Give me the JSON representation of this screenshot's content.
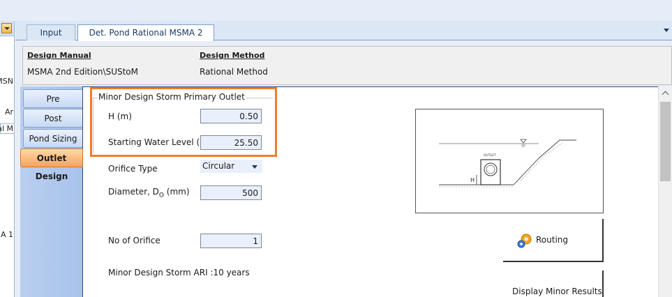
{
  "left_pane": {
    "fragments": [
      "MSN",
      "Ar",
      "al M",
      "A 1"
    ]
  },
  "tabs": [
    {
      "label": "Input",
      "active": false
    },
    {
      "label": "Det. Pond Rational MSMA 2",
      "active": true
    }
  ],
  "header": {
    "design_manual_label": "Design Manual",
    "design_manual_value": "MSMA 2nd Edition\\SUStoM",
    "design_method_label": "Design Method",
    "design_method_value": "Rational Method"
  },
  "side_tabs": [
    {
      "label": "Pre",
      "active": false
    },
    {
      "label": "Post",
      "active": false
    },
    {
      "label": "Pond Sizing",
      "active": false
    },
    {
      "label": "Outlet Design",
      "active": true
    }
  ],
  "outlet": {
    "group_title": "Minor Design Storm Primary Outlet",
    "h_label": "H (m)",
    "h_value": "0.50",
    "swl_label": "Starting Water Level (m)",
    "swl_value": "25.50",
    "orifice_type_label": "Orifice Type",
    "orifice_type_value": "Circular",
    "diameter_label": "Diameter, D",
    "diameter_sub": "O",
    "diameter_unit": " (mm)",
    "diameter_value": "500",
    "no_orifice_label": "No of Orifice",
    "no_orifice_value": "1",
    "ari_label": "Minor Design Storm ARI",
    "ari_value": ":10 years"
  },
  "diagram": {
    "outlet_label": "OUTLET",
    "h_label": "H"
  },
  "buttons": {
    "routing": "Routing",
    "display_minor": "Display Minor Results"
  },
  "colors": {
    "highlight": "#f07c2a",
    "active_tab": "#f7a35c",
    "tab_column": "#b9cff0"
  }
}
